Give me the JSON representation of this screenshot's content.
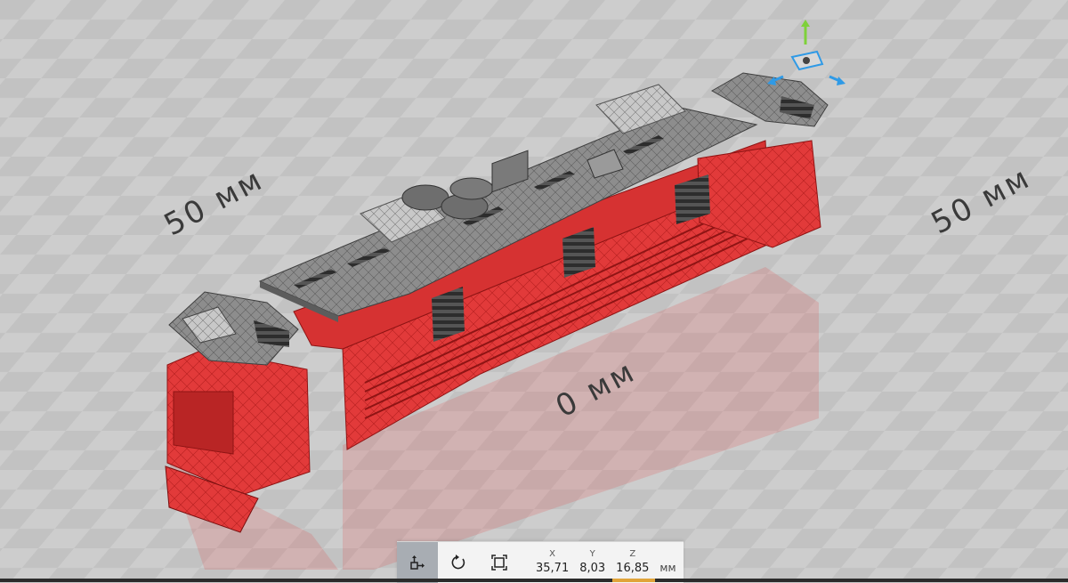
{
  "viewport": {
    "grid_labels": {
      "left": "50 мм",
      "right": "50 мм",
      "center": "0 мм"
    }
  },
  "toolbar": {
    "buttons": [
      {
        "name": "move-tool-button",
        "icon": "move-icon",
        "active": true
      },
      {
        "name": "rotate-tool-button",
        "icon": "rotate-icon",
        "active": false
      },
      {
        "name": "scale-tool-button",
        "icon": "scale-icon",
        "active": false
      }
    ],
    "coords": {
      "x_label": "X",
      "x_value": "35,71",
      "y_label": "Y",
      "y_value": "8,03",
      "z_label": "Z",
      "z_value": "16,85"
    },
    "unit": "мм"
  },
  "colors": {
    "model_red": "#e23a3a",
    "model_gray": "#8a8a8a",
    "gizmo_green": "#7ed13a",
    "gizmo_blue": "#2f9ae6",
    "accent": "#e0a43a"
  }
}
